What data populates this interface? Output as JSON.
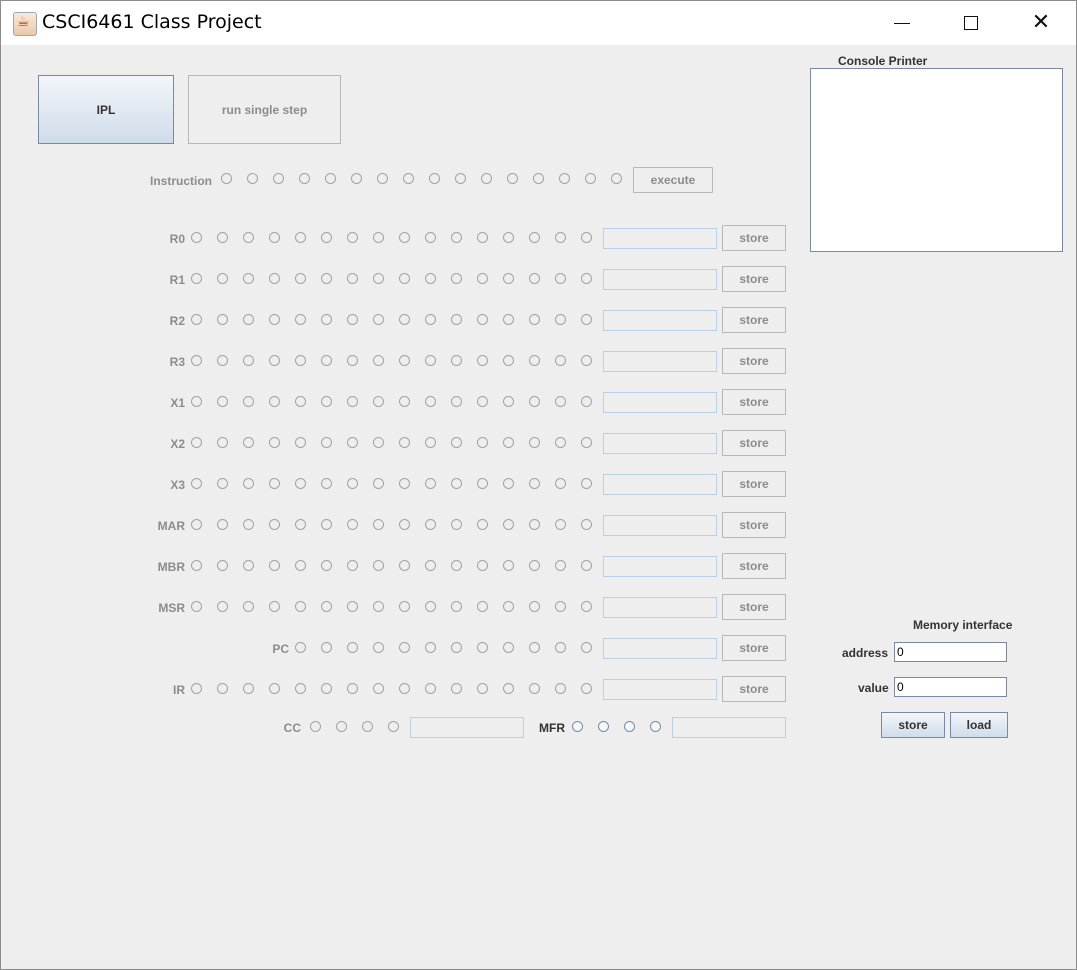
{
  "window": {
    "title": "CSCI6461 Class Project",
    "controls": [
      "minimize-icon",
      "maximize-icon",
      "close-icon"
    ],
    "close_glyph": "✕"
  },
  "controls": {
    "ipl_label": "IPL",
    "step_label": "run single step"
  },
  "instruction": {
    "label": "Instruction",
    "bit_count": 16,
    "execute_label": "execute"
  },
  "registers": [
    {
      "name": "R0",
      "bits": 16,
      "value": "",
      "store_label": "store"
    },
    {
      "name": "R1",
      "bits": 16,
      "value": "",
      "store_label": "store"
    },
    {
      "name": "R2",
      "bits": 16,
      "value": "",
      "store_label": "store"
    },
    {
      "name": "R3",
      "bits": 16,
      "value": "",
      "store_label": "store"
    },
    {
      "name": "X1",
      "bits": 16,
      "value": "",
      "store_label": "store"
    },
    {
      "name": "X2",
      "bits": 16,
      "value": "",
      "store_label": "store"
    },
    {
      "name": "X3",
      "bits": 16,
      "value": "",
      "store_label": "store"
    },
    {
      "name": "MAR",
      "bits": 16,
      "value": "",
      "store_label": "store"
    },
    {
      "name": "MBR",
      "bits": 16,
      "value": "",
      "store_label": "store"
    },
    {
      "name": "MSR",
      "bits": 16,
      "value": "",
      "store_label": "store"
    },
    {
      "name": "PC",
      "bits": 12,
      "value": "",
      "store_label": "store"
    },
    {
      "name": "IR",
      "bits": 16,
      "value": "",
      "store_label": "store"
    }
  ],
  "cc": {
    "label": "CC",
    "bits": 4,
    "value": ""
  },
  "mfr": {
    "label": "MFR",
    "bits": 4,
    "value": ""
  },
  "console": {
    "label": "Console Printer",
    "content": ""
  },
  "memory": {
    "title": "Memory interface",
    "address_label": "address",
    "address_value": "0",
    "value_label": "value",
    "value_value": "0",
    "store_label": "store",
    "load_label": "load"
  },
  "colors": {
    "background": "#eeeeee",
    "disabled_text": "#8c8c8c",
    "enabled_text": "#333333",
    "accent_border": "#7a8aa6",
    "field_border": "#b8cfe5"
  }
}
